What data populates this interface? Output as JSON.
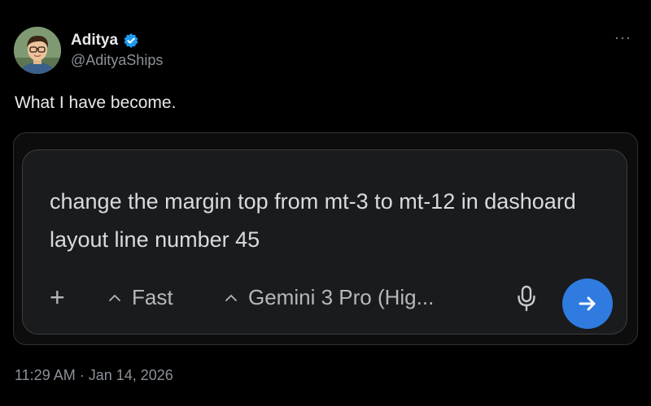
{
  "author": {
    "display_name": "Aditya",
    "handle": "@AdityaShips",
    "verified": true
  },
  "more_label": "···",
  "tweet_text": "What I have become.",
  "prompt": {
    "text": "change the margin top from mt-3 to mt-12 in dashoard layout line number 45",
    "plus_label": "+",
    "mode_label": "Fast",
    "model_label": "Gemini 3 Pro (Hig..."
  },
  "timestamp": "11:29 AM · Jan 14, 2026",
  "colors": {
    "background": "#000000",
    "send_button": "#2f7be0",
    "verified_badge": "#1d9bf0"
  },
  "icons": {
    "verified": "verified-badge-icon",
    "more": "more-dots-icon",
    "plus": "plus-icon",
    "caret": "caret-up-icon",
    "mic": "microphone-icon",
    "send": "arrow-right-icon"
  }
}
